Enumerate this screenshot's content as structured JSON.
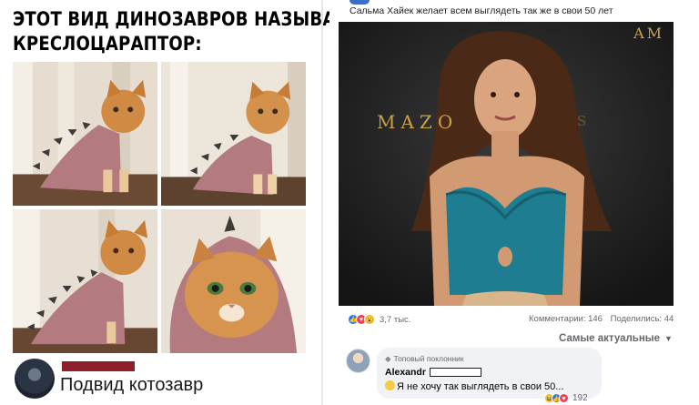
{
  "meme": {
    "title_line1": "ЭТОТ ВИД ДИНОЗАВРОВ НАЗЫВАЕТСЯ",
    "title_line2": "КРЕСЛОЦАРАПТОР:",
    "author_name": "Подвид котозавр"
  },
  "post": {
    "caption": "Сальма Хайек желает всем выглядеть так же в свои 50 лет",
    "backdrop_text": "MAZO",
    "backdrop_text_right": "AM",
    "backdrop_text_dim": "S",
    "reactions": {
      "count": "3,7 тыс.",
      "comments": "Комментарии: 146",
      "shares": "Поделились: 44"
    },
    "sort_label": "Самые актуальные",
    "comment": {
      "badge": "Топовый поклонник",
      "author": "Alexandr",
      "text": "Я не хочу так выглядеть в свои 50...",
      "reaction_count": "192"
    }
  },
  "colors": {
    "fb_blue": "#1877f2",
    "love_red": "#f33e58",
    "gold_backdrop": "#c9a24a",
    "dress_teal": "#1e7d90",
    "cat_orange": "#d08a43",
    "costume_pink": "#b37a7f"
  }
}
